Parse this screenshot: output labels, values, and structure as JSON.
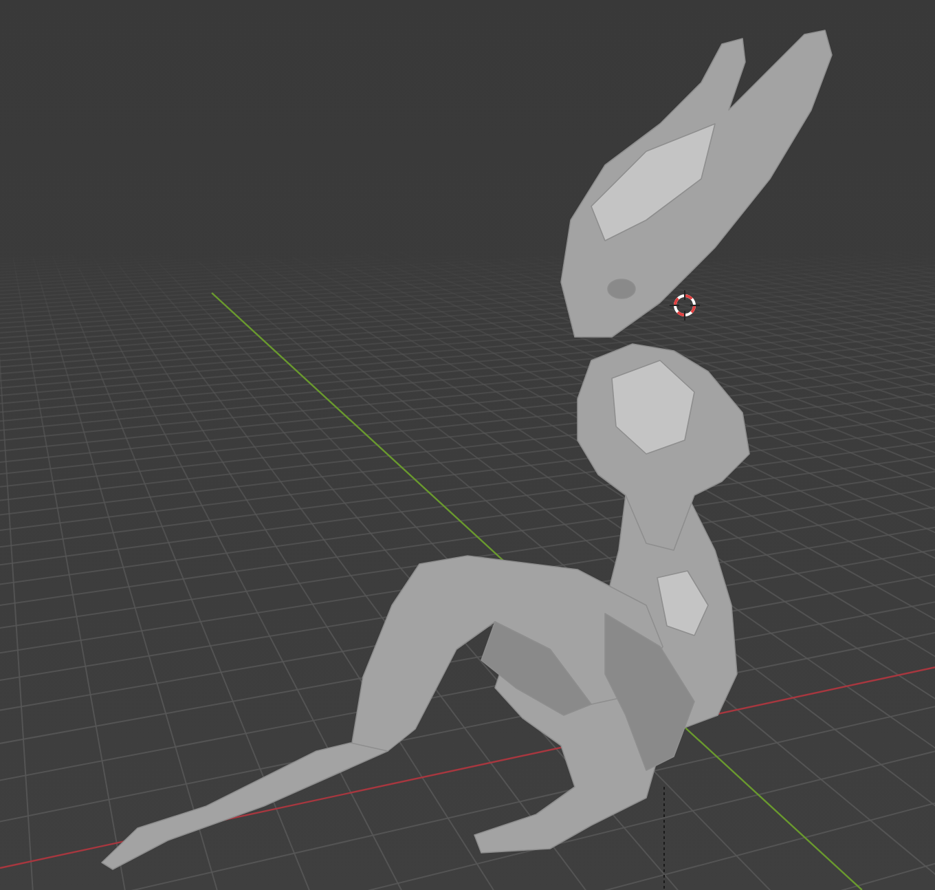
{
  "viewport": {
    "kind": "perspective",
    "show_3d_cursor": true
  }
}
